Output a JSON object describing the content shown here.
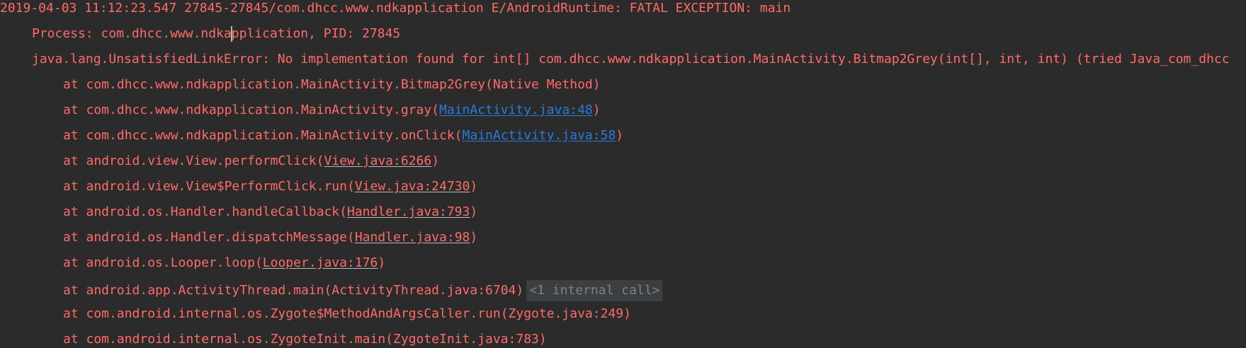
{
  "colors": {
    "background": "#2b2b2b",
    "error_text": "#ff6b68",
    "link": "#287bde",
    "fold_bg": "#3c3f41",
    "fold_text": "#808080"
  },
  "log": {
    "header": "2019-04-03 11:12:23.547 27845-27845/com.dhcc.www.ndkapplication E/AndroidRuntime: FATAL EXCEPTION: main",
    "process_before_caret": "Process: com.dhcc.www.ndka",
    "process_after_caret": "pplication, PID: 27845",
    "exception": "java.lang.UnsatisfiedLinkError: No implementation found for int[] com.dhcc.www.ndkapplication.MainActivity.Bitmap2Grey(int[], int, int) (tried Java_com_dhcc",
    "frames": [
      {
        "text": "at com.dhcc.www.ndkapplication.MainActivity.Bitmap2Grey(Native Method)"
      },
      {
        "prefix": "at com.dhcc.www.ndkapplication.MainActivity.gray(",
        "link": "MainActivity.java:48",
        "suffix": ")"
      },
      {
        "prefix": "at com.dhcc.www.ndkapplication.MainActivity.onClick(",
        "link": "MainActivity.java:58",
        "suffix": ")"
      },
      {
        "prefix": "at android.view.View.performClick(",
        "link": "View.java:6266",
        "suffix": ")"
      },
      {
        "prefix": "at android.view.View$PerformClick.run(",
        "link": "View.java:24730",
        "suffix": ")"
      },
      {
        "prefix": "at android.os.Handler.handleCallback(",
        "link": "Handler.java:793",
        "suffix": ")"
      },
      {
        "prefix": "at android.os.Handler.dispatchMessage(",
        "link": "Handler.java:98",
        "suffix": ")"
      },
      {
        "prefix": "at android.os.Looper.loop(",
        "link": "Looper.java:176",
        "suffix": ")"
      },
      {
        "text": "at android.app.ActivityThread.main(ActivityThread.java:6704)",
        "fold": "<1 internal call>"
      },
      {
        "text": "at com.android.internal.os.Zygote$MethodAndArgsCaller.run(Zygote.java:249)"
      },
      {
        "text": "at com.android.internal.os.ZygoteInit.main(ZygoteInit.java:783)"
      }
    ]
  }
}
